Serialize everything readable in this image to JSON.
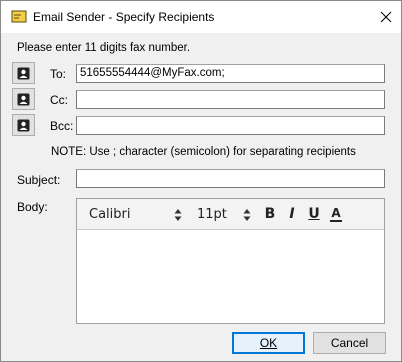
{
  "window": {
    "title": "Email Sender - Specify Recipients",
    "title_icon": "envelope-icon",
    "close_icon": "close-icon"
  },
  "instructions": "Please enter 11 digits fax number.",
  "fields": {
    "to": {
      "label": "To:",
      "value": "51655554444@MyFax.com;"
    },
    "cc": {
      "label": "Cc:",
      "value": ""
    },
    "bcc": {
      "label": "Bcc:",
      "value": ""
    },
    "address_book_icon": "contact-book-icon"
  },
  "note": "NOTE: Use ; character (semicolon) for separating recipients",
  "subject": {
    "label": "Subject:",
    "value": ""
  },
  "body": {
    "label": "Body:",
    "font_name": "Calibri",
    "font_size": "11pt",
    "bold": "B",
    "italic": "I",
    "underline": "U",
    "font_color": "A",
    "content": ""
  },
  "buttons": {
    "ok": "OK",
    "cancel": "Cancel"
  },
  "colors": {
    "accent": "#0078d7",
    "title_icon": "#e8c22c"
  }
}
